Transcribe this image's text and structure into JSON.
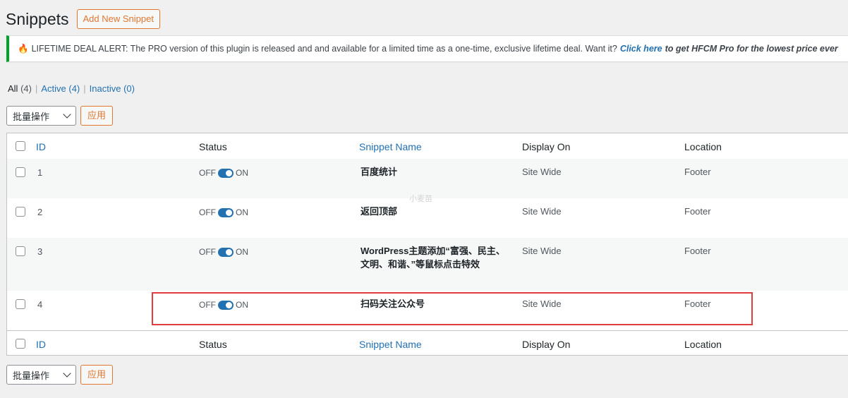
{
  "header": {
    "title": "Snippets",
    "add_new_label": "Add New Snippet"
  },
  "notice": {
    "icon": "fire-icon",
    "text": "LIFETIME DEAL ALERT: The PRO version of this plugin is released and and available for a limited time as a one-time, exclusive lifetime deal. Want it?",
    "cta": "Click here",
    "cta_rest": "to get HFCM Pro for the lowest price ever"
  },
  "filters": {
    "all": "All",
    "all_count": "(4)",
    "active": "Active (4)",
    "inactive": "Inactive (0)"
  },
  "bulk_top": {
    "select_value": "批量操作",
    "apply": "应用"
  },
  "bulk_bottom": {
    "select_value": "批量操作",
    "apply": "应用"
  },
  "columns": {
    "id": "ID",
    "status": "Status",
    "name": "Snippet Name",
    "display": "Display On",
    "location": "Location"
  },
  "toggle": {
    "off": "OFF",
    "on": "ON"
  },
  "rows": [
    {
      "id": "1",
      "name": "百度统计",
      "display": "Site Wide",
      "location": "Footer"
    },
    {
      "id": "2",
      "name": "返回顶部",
      "display": "Site Wide",
      "location": "Footer"
    },
    {
      "id": "3",
      "name": "WordPress主题添加“富强、民主、文明、和谐、”等鼠标点击特效",
      "display": "Site Wide",
      "location": "Footer"
    },
    {
      "id": "4",
      "name": "扫码关注公众号",
      "display": "Site Wide",
      "location": "Footer"
    }
  ],
  "watermark": "小麦苗",
  "colors": {
    "accent": "#e27730",
    "link": "#2271b1",
    "notice_border": "#00a32a",
    "highlight": "#e03e3e"
  }
}
